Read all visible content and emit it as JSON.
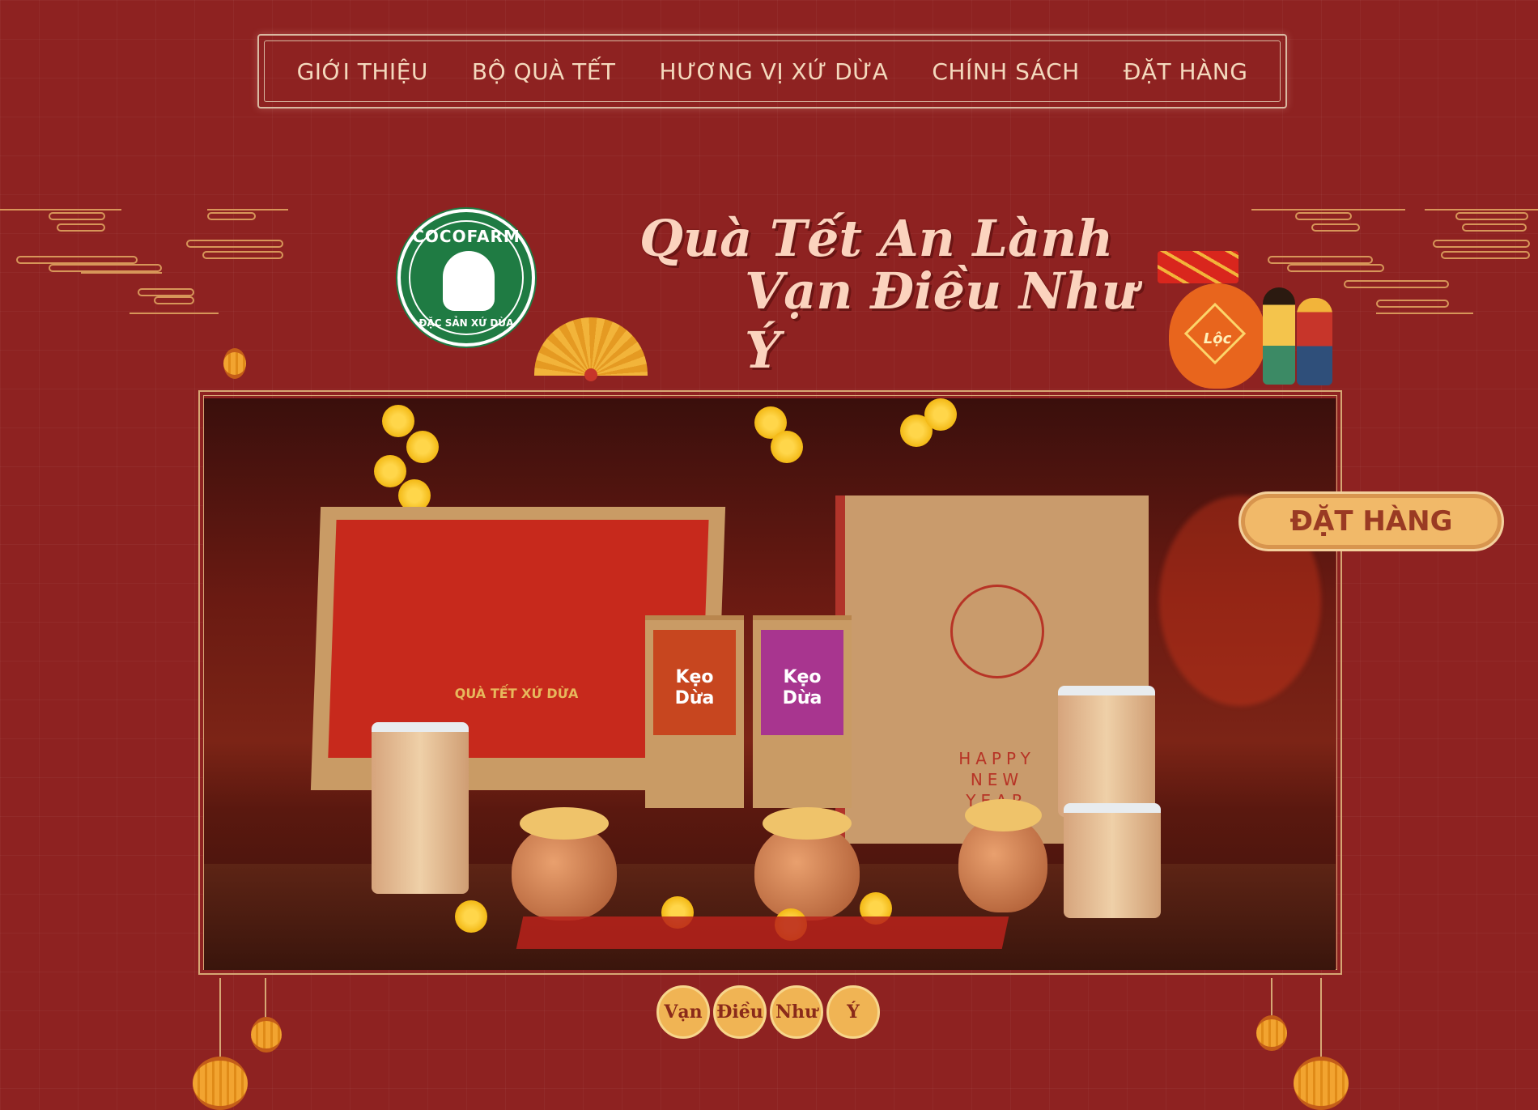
{
  "nav": {
    "items": [
      "GIỚI THIỆU",
      "BỘ QUÀ TẾT",
      "HƯƠNG VỊ XỨ DỪA",
      "CHÍNH SÁCH",
      "ĐẶT HÀNG"
    ]
  },
  "logo": {
    "brand": "COCOFARM",
    "tagline": "ĐẶC SẢN XỨ DỪA"
  },
  "headline": {
    "line1": "Quà Tết An Lành",
    "line2": "Vạn Điều Như Ý"
  },
  "photo": {
    "gift_box_label": "QUÀ TẾT XỨ DỪA",
    "bag_text": "HAPPY\nNEW\nYEAR",
    "candy_box_1": "Kẹo\nDừa",
    "candy_box_2": "Kẹo\nDừa"
  },
  "decor": {
    "money_bag_label": "Lộc"
  },
  "order_button": {
    "label": "ĐẶT HÀNG"
  },
  "motto": [
    "Vạn",
    "Điều",
    "Như",
    "Ý"
  ],
  "colors": {
    "background": "#8e2221",
    "nav_text": "#f4d9bd",
    "accent_gold": "#f1b969",
    "logo_green": "#1f7b43",
    "headline": "#fbd3be"
  }
}
